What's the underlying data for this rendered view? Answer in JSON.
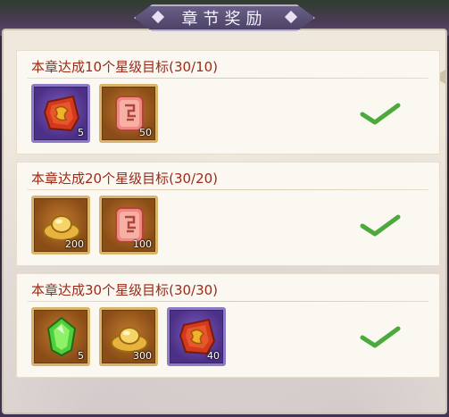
{
  "header": {
    "title": "章节奖励"
  },
  "rewards": [
    {
      "label": "本章达成10个星级目标(30/10)",
      "claimed": true,
      "items": [
        {
          "icon": "red-token-icon",
          "quality": "purple",
          "count": "5"
        },
        {
          "icon": "red-seal-icon",
          "quality": "gold",
          "count": "50"
        }
      ]
    },
    {
      "label": "本章达成20个星级目标(30/20)",
      "claimed": true,
      "items": [
        {
          "icon": "gold-ingot-icon",
          "quality": "gold",
          "count": "200"
        },
        {
          "icon": "red-seal-icon",
          "quality": "gold",
          "count": "100"
        }
      ]
    },
    {
      "label": "本章达成30个星级目标(30/30)",
      "claimed": true,
      "items": [
        {
          "icon": "green-gem-icon",
          "quality": "gold",
          "count": "5"
        },
        {
          "icon": "gold-ingot-icon",
          "quality": "gold",
          "count": "300"
        },
        {
          "icon": "red-token-icon",
          "quality": "purple",
          "count": "40"
        }
      ]
    }
  ],
  "colors": {
    "title_text": "#9a2a1a",
    "check": "#4caa3c",
    "purple_frame": "#8c7bc7",
    "gold_frame": "#d8b46c"
  }
}
